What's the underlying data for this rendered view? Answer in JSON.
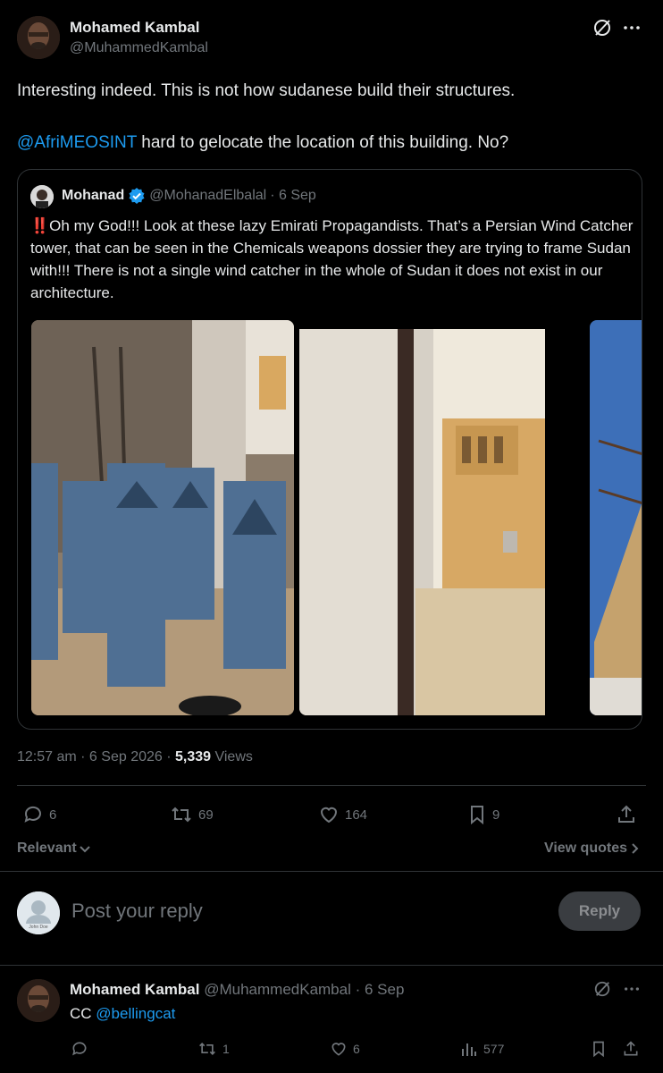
{
  "post": {
    "author_name": "Mohamed Kambal",
    "author_handle": "@MuhammedKambal",
    "text_line1": "Interesting indeed. This is not how sudanese build their structures.",
    "mention": "@AfriMEOSINT",
    "text_line2": " hard to gelocate the location of this building. No?",
    "time": "12:57 am · 6 Sep 2026 · ",
    "views_count": "5,339",
    "views_label": " Views"
  },
  "quote": {
    "author_name": "Mohanad",
    "author_handle": "@MohanadElbalal",
    "date": " · 6 Sep",
    "alert_glyph": "‼️",
    "text": "Oh my God!!! Look at these lazy Emirati Propagandists. That’s a Persian Wind Catcher tower, that can be seen in the Chemicals weapons dossier they are trying to frame Sudan with!!! There is not a single wind catcher in the whole of Sudan it does not exist in our architecture."
  },
  "actions": {
    "replies": "6",
    "reposts": "69",
    "likes": "164",
    "bookmarks": "9"
  },
  "sort": {
    "relevant_label": "Relevant",
    "view_quotes_label": "View quotes"
  },
  "composer": {
    "placeholder": "Post your reply",
    "avatar_caption": "John Doe",
    "reply_button": "Reply"
  },
  "reply": {
    "author_name": "Mohamed Kambal",
    "author_handle": "@MuhammedKambal",
    "date": " · 6 Sep",
    "text_prefix": "CC ",
    "mention": "@bellingcat",
    "replies": "",
    "reposts": "1",
    "likes": "6",
    "views": "577"
  },
  "colors": {
    "background": "#000000",
    "text": "#e7e9ea",
    "muted": "#71767b",
    "accent": "#1d9bf0",
    "divider": "#2f3336"
  }
}
